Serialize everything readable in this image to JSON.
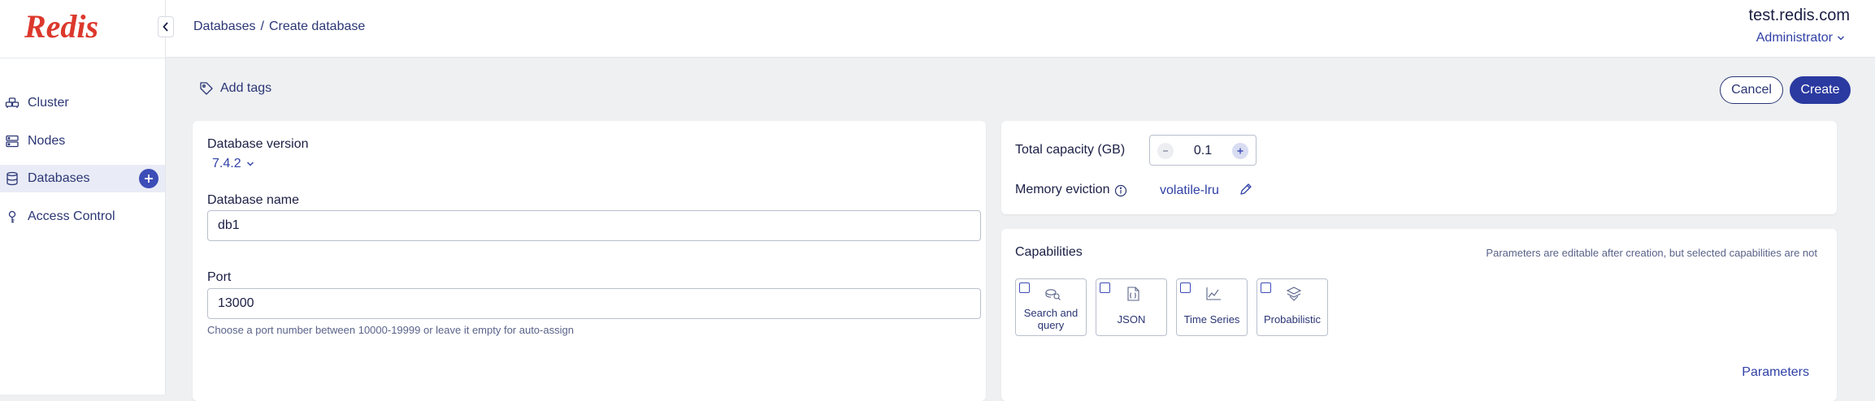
{
  "brand": {
    "logo_text": "Redis",
    "logo_color": "#dc382c",
    "accent": "#2b3aa0"
  },
  "sidebar": {
    "items": [
      {
        "label": "Cluster",
        "icon": "cluster-icon",
        "active": false
      },
      {
        "label": "Nodes",
        "icon": "nodes-icon",
        "active": false
      },
      {
        "label": "Databases",
        "icon": "databases-icon",
        "active": true
      },
      {
        "label": "Access Control",
        "icon": "access-control-icon",
        "active": false
      }
    ]
  },
  "header": {
    "breadcrumb": [
      "Databases",
      "Create database"
    ],
    "separator": "/",
    "host": "test.redis.com",
    "role": "Administrator"
  },
  "toolbar": {
    "add_tags": "Add tags",
    "cancel_label": "Cancel",
    "create_label": "Create"
  },
  "form": {
    "version_label": "Database version",
    "version_value": "7.4.2",
    "name_label": "Database name",
    "name_value": "db1",
    "port_label": "Port",
    "port_value": "13000",
    "port_hint": "Choose a port number between 10000-19999 or leave it empty for auto-assign"
  },
  "capacity": {
    "label": "Total capacity (GB)",
    "value": "0.1",
    "eviction_label": "Memory eviction",
    "eviction_value": "volatile-lru"
  },
  "capabilities": {
    "title": "Capabilities",
    "note": "Parameters are editable after creation, but selected capabilities are not",
    "items": [
      {
        "label_line1": "Search and",
        "label_line2": "query",
        "icon": "search-query-icon",
        "checked": false
      },
      {
        "label_line1": "JSON",
        "label_line2": "",
        "icon": "json-icon",
        "checked": false
      },
      {
        "label_line1": "Time Series",
        "label_line2": "",
        "icon": "time-series-icon",
        "checked": false
      },
      {
        "label_line1": "Probabilistic",
        "label_line2": "",
        "icon": "probabilistic-icon",
        "checked": false
      }
    ],
    "parameters_link": "Parameters"
  }
}
